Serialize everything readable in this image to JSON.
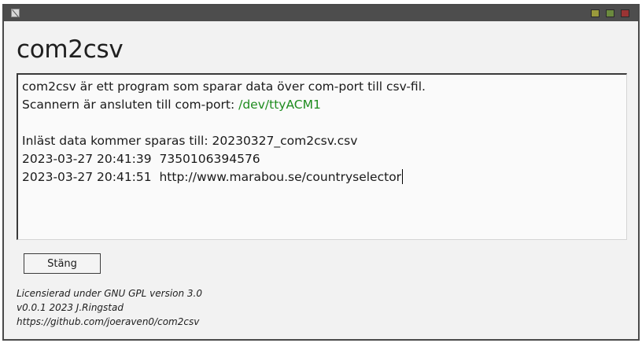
{
  "window": {
    "icon": "app-icon",
    "buttons": [
      "minimize-icon",
      "maximize-icon",
      "close-icon"
    ],
    "button_colors": {
      "minimize": "#9a9a3c",
      "maximize": "#6b8a3e",
      "close": "#9a3434"
    }
  },
  "heading": "com2csv",
  "log": {
    "intro": "com2csv är ett program som sparar data över com-port till csv-fil.",
    "port_prefix": "Scannern är ansluten till com-port: ",
    "port_value": "/dev/ttyACM1",
    "port_color": "#1e8c1e",
    "save_line": "Inläst data kommer sparas till: 20230327_com2csv.csv",
    "entries": [
      "2023-03-27 20:41:39  7350106394576",
      "2023-03-27 20:41:51  http://www.marabou.se/countryselector"
    ]
  },
  "buttons": {
    "close_label": "Stäng"
  },
  "footer": {
    "license": "Licensierad under GNU GPL version 3.0",
    "version": "v0.0.1 2023 J.Ringstad",
    "url": "https://github.com/joeraven0/com2csv"
  }
}
